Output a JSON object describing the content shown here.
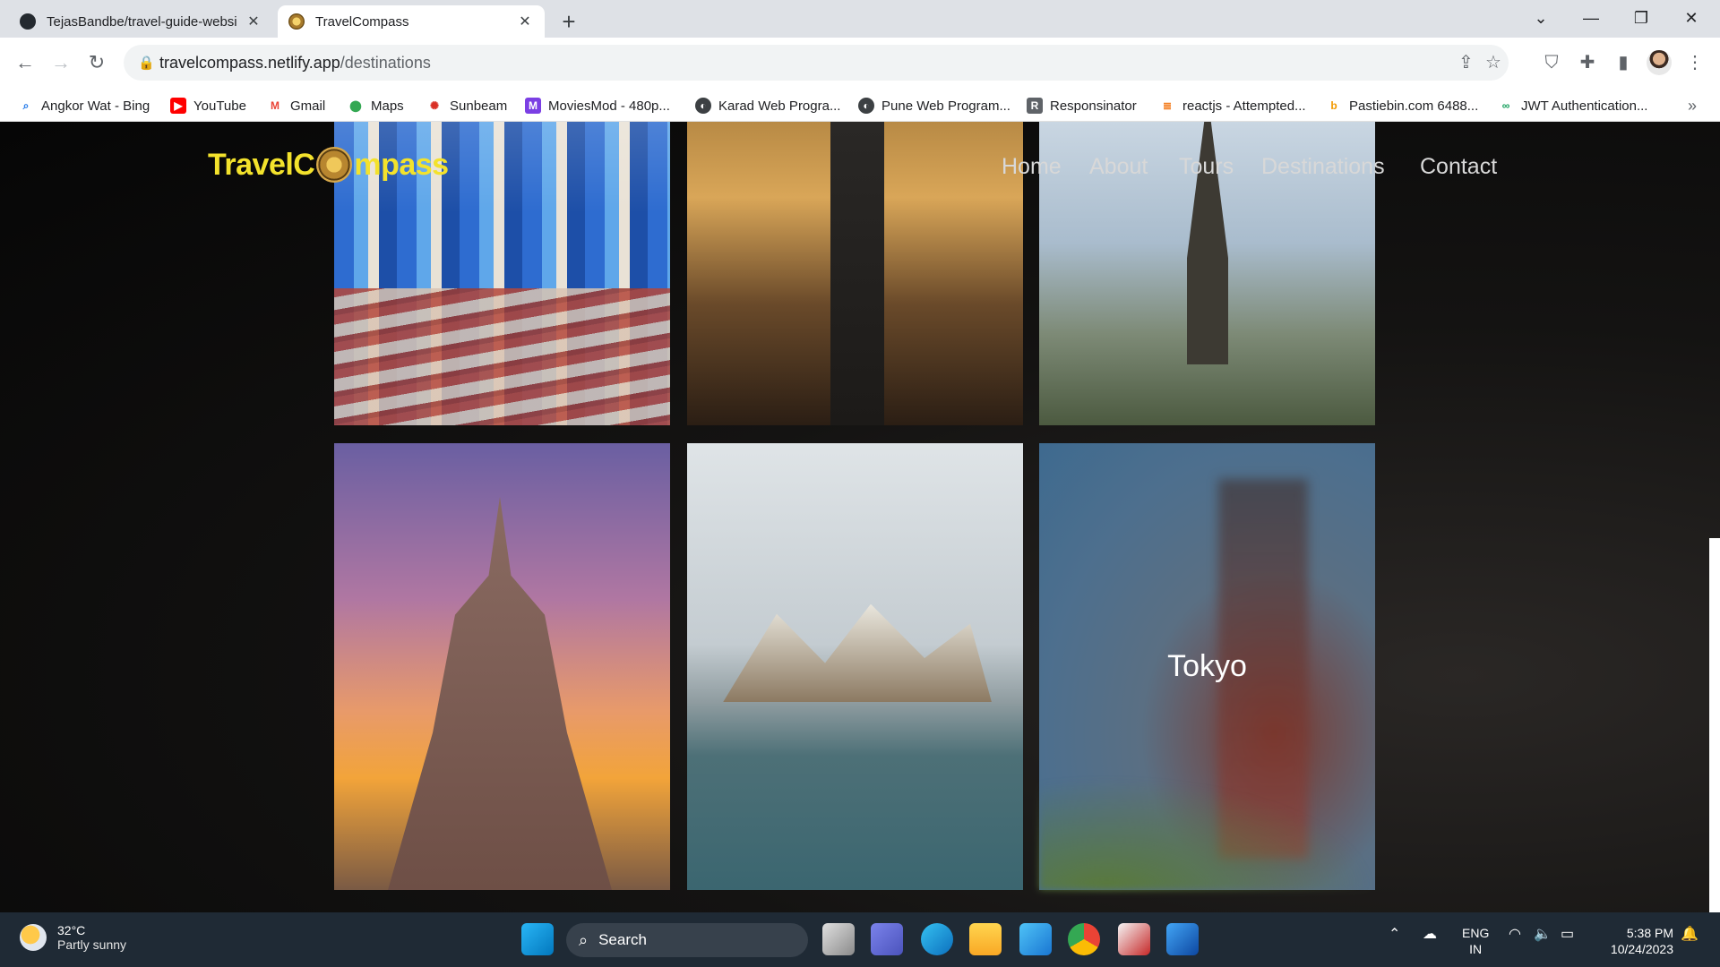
{
  "browser": {
    "tabs": [
      {
        "title": "TejasBandbe/travel-guide-websi",
        "close": "✕"
      },
      {
        "title": "TravelCompass",
        "close": "✕"
      }
    ],
    "new_tab": "+",
    "window_controls": {
      "tab_search": "⌄",
      "minimize": "—",
      "restore": "❐",
      "close": "✕"
    },
    "url_domain": "travelcompass.netlify.app",
    "url_path": "/destinations",
    "bookmarks": [
      {
        "label": "Angkor Wat - Bing",
        "icon": "bing-search-icon",
        "color": "#1a73e8"
      },
      {
        "label": "YouTube",
        "icon": "youtube-icon",
        "color": "#ff0000"
      },
      {
        "label": "Gmail",
        "icon": "gmail-icon",
        "color": "#ea4335"
      },
      {
        "label": "Maps",
        "icon": "maps-icon",
        "color": "#34a853"
      },
      {
        "label": "Sunbeam",
        "icon": "sunbeam-icon",
        "color": "#d93025"
      },
      {
        "label": "MoviesMod - 480p...",
        "icon": "moviesmod-icon",
        "color": "#7b3fe4"
      },
      {
        "label": "Karad Web Progra...",
        "icon": "globe-icon",
        "color": "#3c4043"
      },
      {
        "label": "Pune Web Program...",
        "icon": "globe-icon",
        "color": "#3c4043"
      },
      {
        "label": "Responsinator",
        "icon": "responsinator-icon",
        "color": "#5f6368"
      },
      {
        "label": "reactjs - Attempted...",
        "icon": "stackoverflow-icon",
        "color": "#f48024"
      },
      {
        "label": "Pastiebin.com 6488...",
        "icon": "pastiebin-icon",
        "color": "#f29900"
      },
      {
        "label": "JWT Authentication...",
        "icon": "jwt-icon",
        "color": "#0f9d58"
      }
    ],
    "bookmarks_overflow": "»"
  },
  "site": {
    "logo_left": "TravelC",
    "logo_right": "mpass",
    "logo_color": "#f3e22c",
    "nav": [
      "Home",
      "About",
      "Tours",
      "Destinations",
      "Contact"
    ]
  },
  "destinations": [
    {
      "label": ""
    },
    {
      "label": ""
    },
    {
      "label": ""
    },
    {
      "label": ""
    },
    {
      "label": ""
    },
    {
      "label": "Tokyo"
    }
  ],
  "taskbar": {
    "temperature": "32°C",
    "weather": "Partly sunny",
    "search": "Search",
    "lang1": "ENG",
    "lang2": "IN",
    "time": "5:38 PM",
    "date": "10/24/2023"
  }
}
